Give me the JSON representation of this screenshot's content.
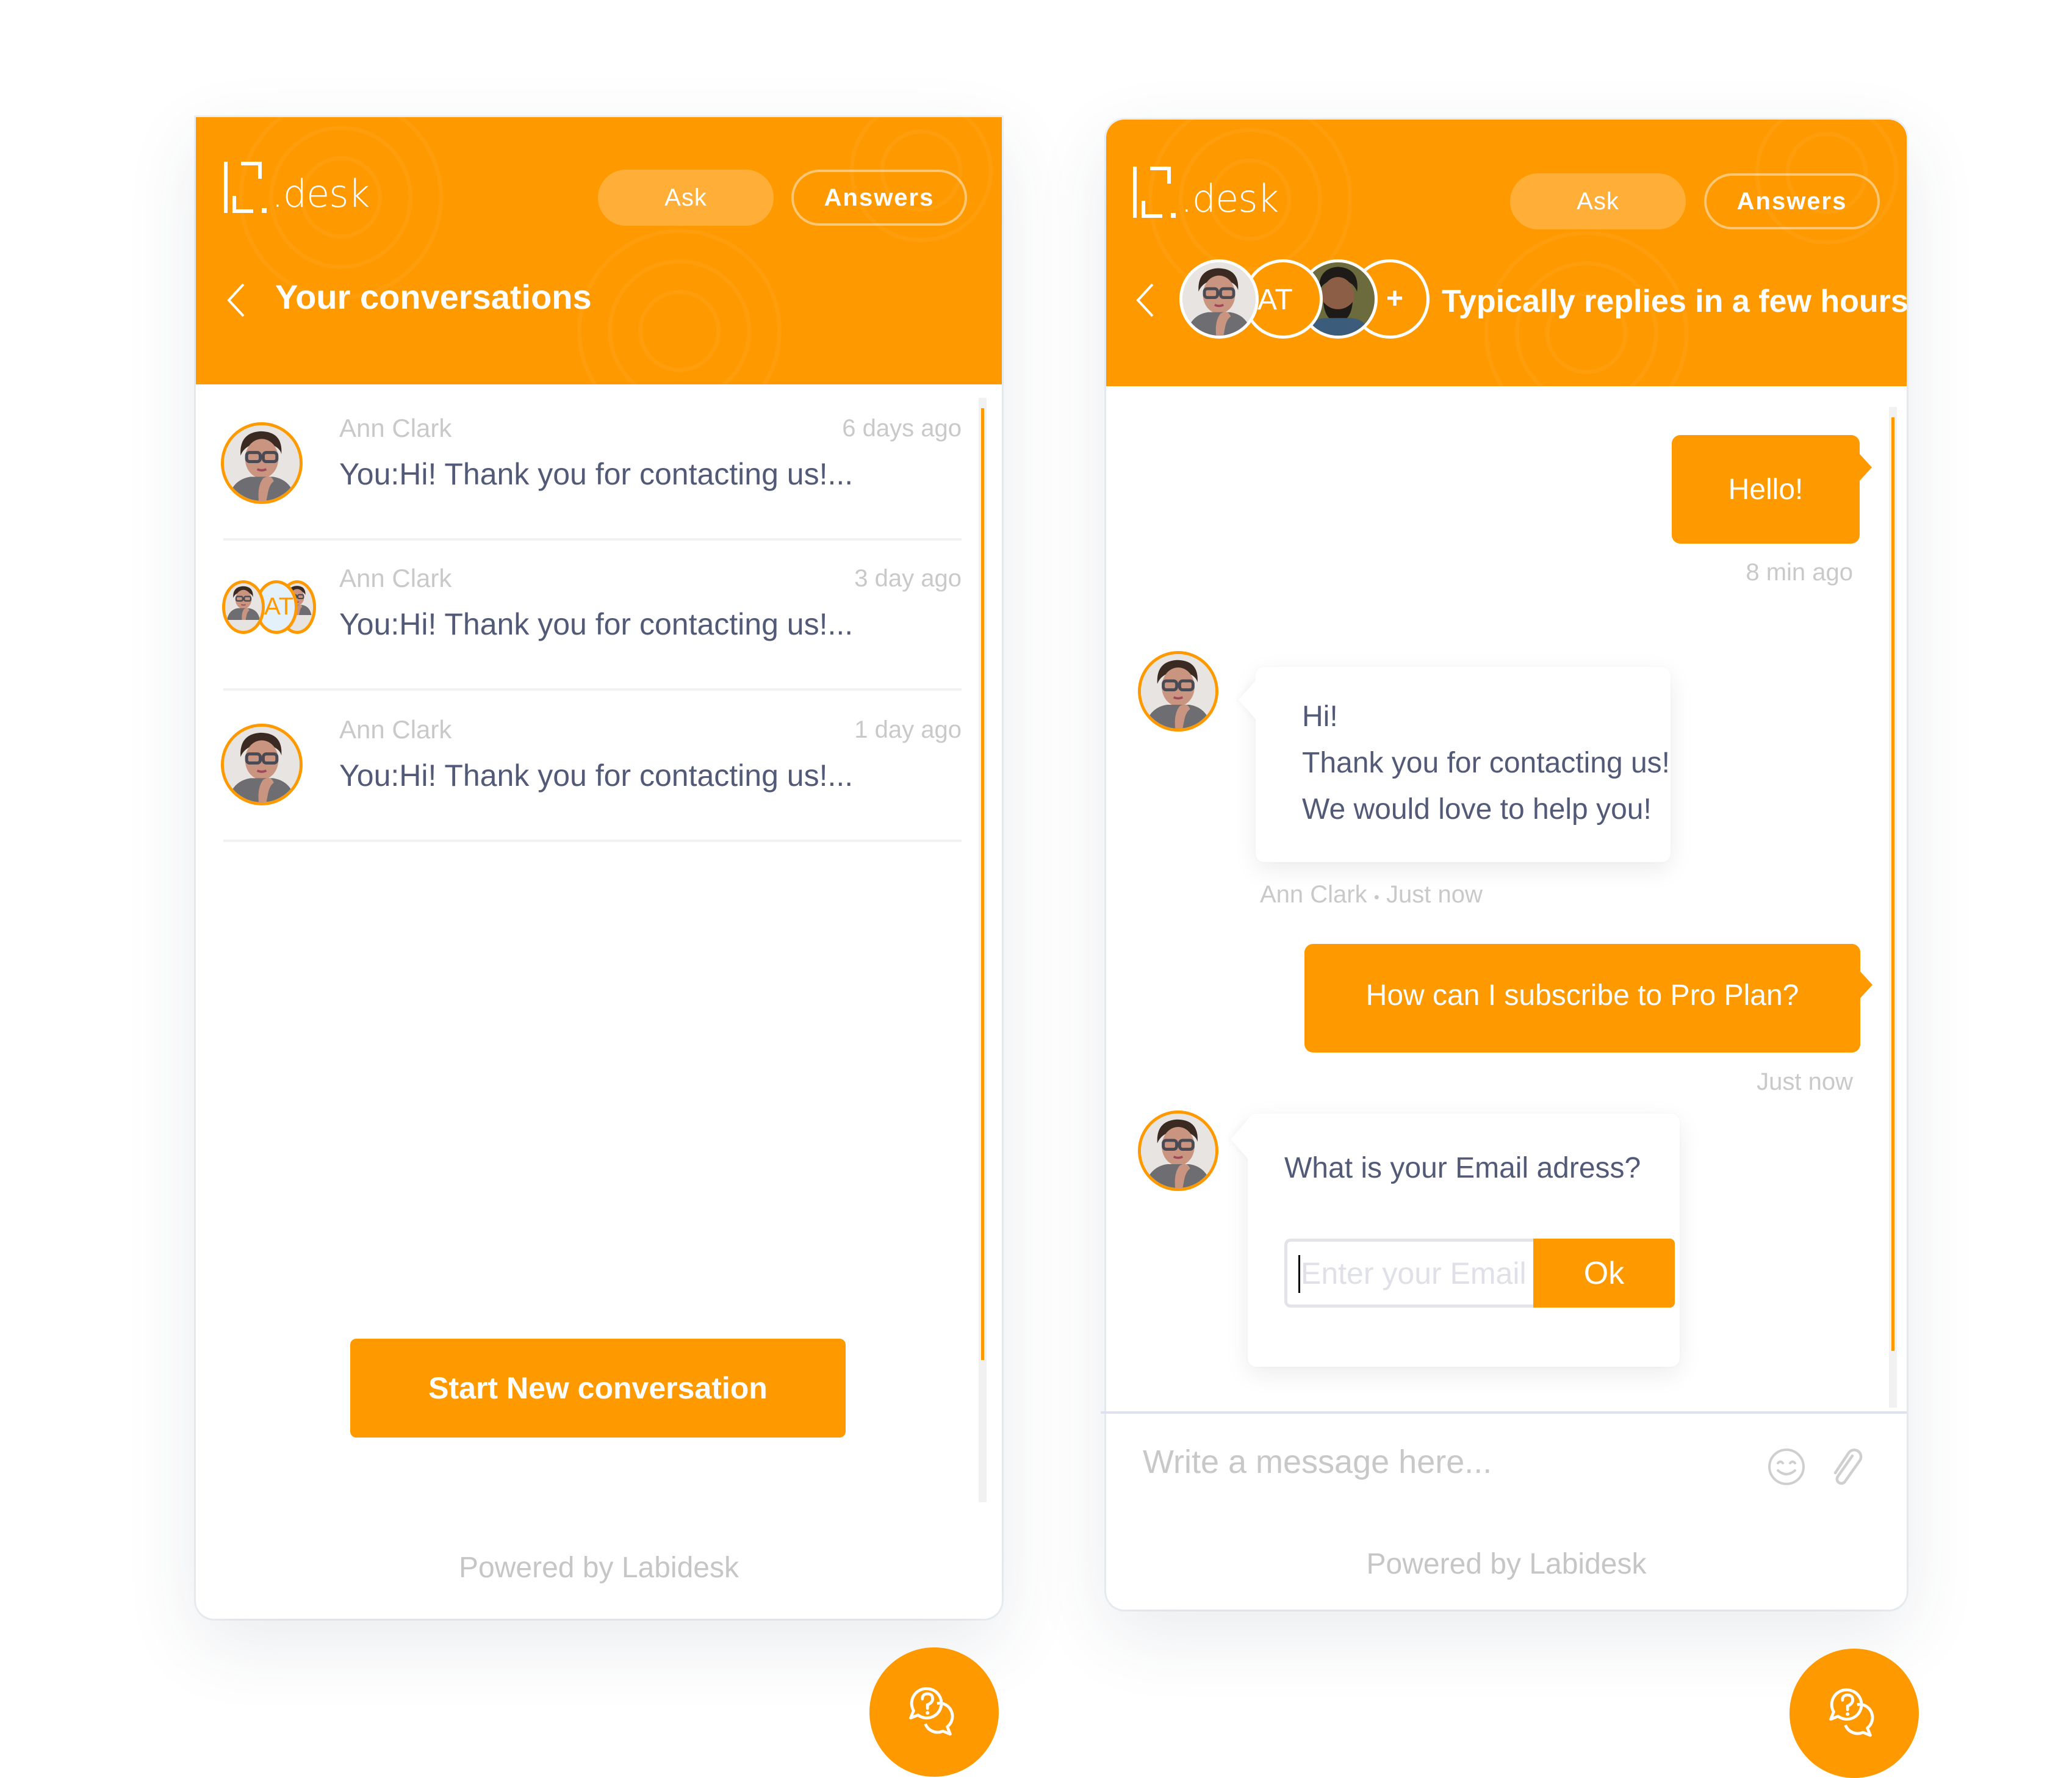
{
  "brand": {
    "logo_text": ".desk",
    "accent_color": "#ff9900",
    "text_dark": "#525a78",
    "text_muted": "#c9c9c9"
  },
  "left_panel": {
    "header": {
      "tabs": [
        {
          "label": "Ask",
          "state": "active"
        },
        {
          "label": "Answers",
          "state": "outline"
        }
      ],
      "back_icon": "chevron-left-icon",
      "title": "Your conversations"
    },
    "conversations": [
      {
        "name": "Ann Clark",
        "time": "6 days ago",
        "preview": "You:Hi! Thank you for contacting us!...",
        "avatar": "single"
      },
      {
        "name": "Ann Clark",
        "time": "3 day ago",
        "preview": "You:Hi! Thank you for contacting us!...",
        "avatar": "group",
        "group_initials": "AT"
      },
      {
        "name": "Ann Clark",
        "time": "1 day ago",
        "preview": "You:Hi! Thank you for contacting us!...",
        "avatar": "single"
      }
    ],
    "start_button": "Start New conversation",
    "powered_by": "Powered by Labidesk"
  },
  "right_panel": {
    "header": {
      "tabs": [
        {
          "label": "Ask",
          "state": "active"
        },
        {
          "label": "Answers",
          "state": "outline"
        }
      ],
      "back_icon": "chevron-left-icon",
      "agents": [
        {
          "type": "photo",
          "name": "Ann Clark"
        },
        {
          "type": "initials",
          "initials": "AT"
        },
        {
          "type": "photo",
          "name": "agent"
        },
        {
          "type": "more",
          "symbol": "+"
        }
      ],
      "status": "Typically replies in a few hours"
    },
    "messages": [
      {
        "from": "user",
        "text": "Hello!",
        "time": "8 min ago"
      },
      {
        "from": "agent",
        "lines": [
          "Hi!",
          "Thank you for contacting us!",
          "We would love to help you!"
        ],
        "meta_name": "Ann Clark",
        "meta_sep": "•",
        "meta_time": "Just now"
      },
      {
        "from": "user",
        "text": "How can I subscribe to Pro Plan?",
        "time": "Just now"
      },
      {
        "from": "agent",
        "question": "What is your Email adress?",
        "input_placeholder": "Enter your Email adress",
        "input_value": "",
        "submit_label": "Ok"
      }
    ],
    "composer": {
      "placeholder": "Write a message here...",
      "emoji_icon": "emoji-icon",
      "attach_icon": "paperclip-icon"
    },
    "powered_by": "Powered by Labidesk"
  },
  "launcher": {
    "icon": "help-chat-icon"
  }
}
